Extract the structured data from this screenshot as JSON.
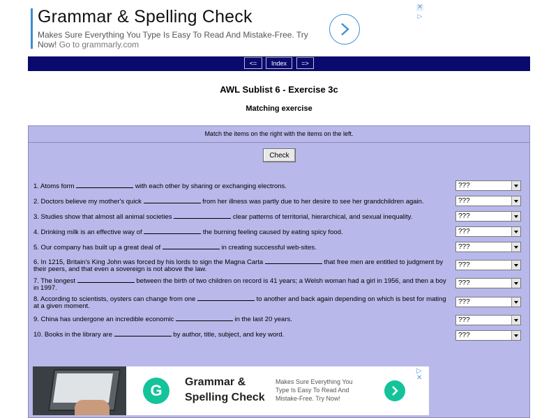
{
  "top_ad": {
    "title": "Grammar & Spelling Check",
    "description": "Makes Sure Everything You Type Is Easy To Read And Mistake-Free. Try Now!",
    "url": "Go to grammarly.com",
    "close_glyph": "✕",
    "adchoices_glyph": "▷"
  },
  "nav": {
    "prev_label": "<=",
    "index_label": "Index",
    "next_label": "=>"
  },
  "page": {
    "title": "AWL Sublist 6 - Exercise 3c",
    "subtitle": "Matching exercise"
  },
  "exercise": {
    "instruction": "Match the items on the right with the items on the left.",
    "check_label": "Check",
    "select_default": "???",
    "questions": [
      {
        "before": "1. Atoms form ",
        "after": " with each other by sharing or exchanging electrons."
      },
      {
        "before": "2. Doctors believe my mother's quick ",
        "after": " from her illness was partly due to her desire to see her grandchildren again."
      },
      {
        "before": "3. Studies show that almost all animal societies ",
        "after": " clear patterns of territorial, hierarchical, and sexual inequality."
      },
      {
        "before": "4. Drinking milk is an effective way of ",
        "after": " the burning feeling caused by eating spicy food."
      },
      {
        "before": "5. Our company has built up a great deal of ",
        "after": " in creating successful web-sites."
      },
      {
        "before": "6. In 1215, Britain's King John was forced by his lords to sign the Magna Carta ",
        "after": " that free men are entitled to judgment by their peers, and that even a sovereign is not above the law."
      },
      {
        "before": "7. The longest ",
        "after": " between the birth of two children on record is 41 years; a Welsh woman had a girl in 1956, and then a boy in 1997."
      },
      {
        "before": "8. According to scientists, oysters can change from one ",
        "after": " to another and back again depending on which is best for mating at a given moment."
      },
      {
        "before": "9. China has undergone an incredible economic ",
        "after": " in the last 20 years."
      },
      {
        "before": "10. Books in the library are ",
        "after": " by author, title, subject, and key word."
      }
    ]
  },
  "bottom_ad": {
    "logo_letter": "G",
    "title_line1": "Grammar &",
    "title_line2": "Spelling Check",
    "description": "Makes Sure Everything You Type Is Easy To Read And Mistake-Free. Try Now!",
    "close_glyph": "▷ ✕"
  }
}
